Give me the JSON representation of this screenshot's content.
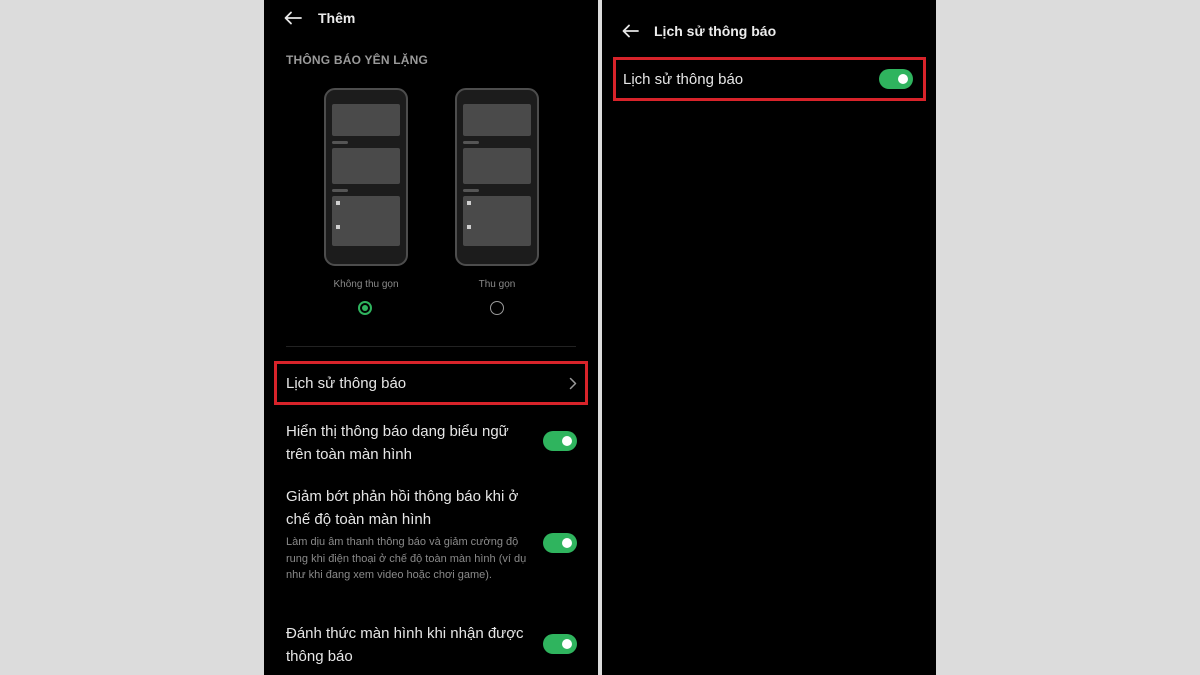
{
  "left": {
    "header_title": "Thêm",
    "section_title": "THÔNG BÁO YÊN LẶNG",
    "options": [
      {
        "label": "Không thu gọn",
        "selected": true
      },
      {
        "label": "Thu gọn",
        "selected": false
      }
    ],
    "history_row": {
      "label": "Lịch sử thông báo"
    },
    "settings": [
      {
        "title": "Hiển thị thông báo dạng biểu ngữ trên toàn màn hình",
        "enabled": true
      },
      {
        "title": "Giảm bớt phản hồi thông báo khi ở chế độ toàn màn hình",
        "description": "Làm dịu âm thanh thông báo và giảm cường độ rung khi điện thoại ở chế độ toàn màn hình (ví dụ như khi đang xem video hoặc chơi game).",
        "enabled": true
      },
      {
        "title": "Đánh thức màn hình khi nhận được thông báo",
        "enabled": true
      }
    ]
  },
  "right": {
    "header_title": "Lịch sử thông báo",
    "toggle_row": {
      "label": "Lịch sử thông báo",
      "enabled": true
    }
  },
  "icons": [
    "back-arrow-icon",
    "chevron-right-icon"
  ],
  "colors": {
    "accent_green": "#2fb45e",
    "highlight_red": "#d8232a",
    "screen_background": "#000000",
    "page_background": "#dcdcdc"
  }
}
